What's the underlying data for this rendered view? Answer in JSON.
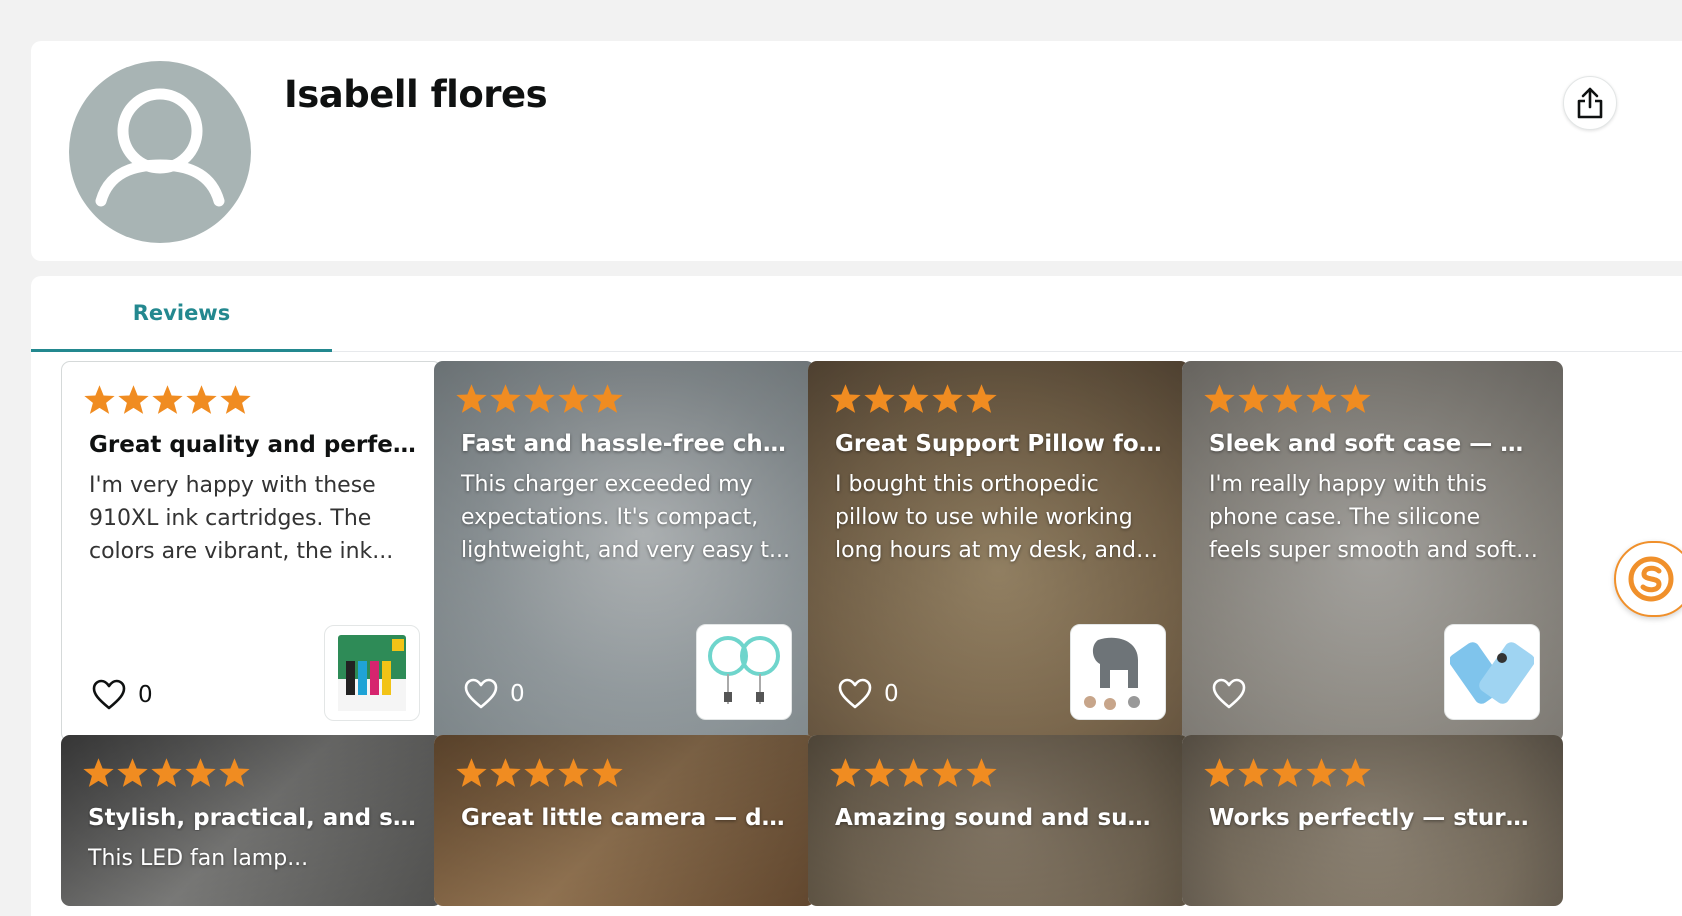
{
  "profile": {
    "name": "Isabell flores",
    "avatar_icon": "user-silhouette-icon",
    "share_icon": "share-icon"
  },
  "tabs": [
    {
      "label": "Reviews",
      "active": true
    }
  ],
  "colors": {
    "accent": "#23888f",
    "star": "#f08c21",
    "badge": "#f0902b"
  },
  "reviews": [
    {
      "rating": 5,
      "title": "Great quality and perfec...",
      "text": "I'm very happy with these 910XL ink cartridges. The colors are vibrant, the ink...",
      "likes": "0",
      "has_photo": false,
      "thumb_icon": "ink-cartridge-pack-icon"
    },
    {
      "rating": 5,
      "title": "Fast and hassle-free char...",
      "text": "This charger exceeded my expectations. It's compact, lightweight, and very easy t...",
      "likes": "0",
      "has_photo": true,
      "thumb_icon": "wireless-charger-icon"
    },
    {
      "rating": 5,
      "title": "Great Support Pillow for ...",
      "text": "I bought this orthopedic pillow to use while working long hours at my desk, and i...",
      "likes": "0",
      "has_photo": true,
      "thumb_icon": "pillow-icon"
    },
    {
      "rating": 5,
      "title": "Sleek and soft case — gr...",
      "text": "I'm really happy with this phone case. The silicone feels super smooth and soft to th...",
      "likes": "",
      "has_photo": true,
      "thumb_icon": "phone-case-icon"
    },
    {
      "rating": 5,
      "title": "Stylish, practical, and su...",
      "text": "This LED fan lamp...",
      "likes": "",
      "has_photo": true
    },
    {
      "rating": 5,
      "title": "Great little camera — dis...",
      "text": "",
      "likes": "",
      "has_photo": true
    },
    {
      "rating": 5,
      "title": "Amazing sound and supe...",
      "text": "",
      "likes": "",
      "has_photo": true
    },
    {
      "rating": 5,
      "title": "Works perfectly — sturd...",
      "text": "",
      "likes": "",
      "has_photo": true
    }
  ],
  "floating_badge_icon": "s-logo-icon"
}
